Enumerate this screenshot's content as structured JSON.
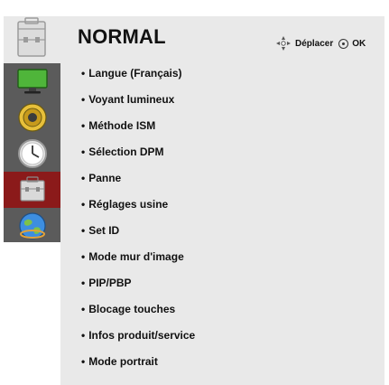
{
  "header": {
    "title": "NORMAL",
    "move_label": "Déplacer",
    "ok_label": "OK"
  },
  "sidebar": {
    "items": [
      {
        "icon": "monitor-icon"
      },
      {
        "icon": "speaker-icon"
      },
      {
        "icon": "clock-icon"
      },
      {
        "icon": "toolbox-icon",
        "active": true
      },
      {
        "icon": "globe-icon"
      }
    ]
  },
  "menu": {
    "items": [
      "Langue (Français)",
      "Voyant lumineux",
      "Méthode ISM",
      "Sélection DPM",
      "Panne",
      "Réglages usine",
      "Set ID",
      "Mode mur d'image",
      "PIP/PBP",
      "Blocage touches",
      "Infos produit/service",
      "Mode portrait"
    ]
  },
  "colors": {
    "header_bg": "#e9e9e9",
    "sidebar_bg": "#5b5b5b",
    "active_item": "#8b1a1a"
  }
}
